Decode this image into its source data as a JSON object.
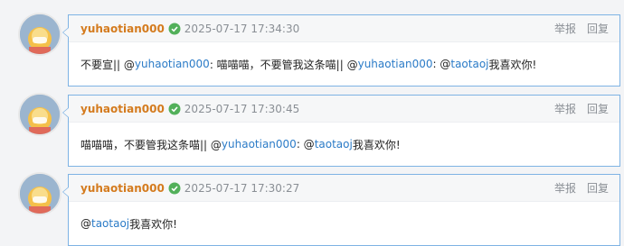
{
  "comments": [
    {
      "username": "yuhaotian000",
      "time": "2025-07-17 17:34:30",
      "report": "举报",
      "reply": "回复",
      "body": {
        "t1": "不要宣|| @",
        "m1": "yuhaotian000",
        "t2": " : 喵喵喵，不要管我这条喵|| @",
        "m2": "yuhaotian000",
        "t3": " : @",
        "m3": "taotaoj",
        "t4": " 我喜欢你!"
      }
    },
    {
      "username": "yuhaotian000",
      "time": "2025-07-17 17:30:45",
      "report": "举报",
      "reply": "回复",
      "body": {
        "t1": "喵喵喵，不要管我这条喵|| @",
        "m1": "yuhaotian000",
        "t2": " : @",
        "m2": "taotaoj",
        "t3": " 我喜欢你!"
      }
    },
    {
      "username": "yuhaotian000",
      "time": "2025-07-17 17:30:27",
      "report": "举报",
      "reply": "回复",
      "body": {
        "t1": "@",
        "m1": "taotaoj",
        "t2": " 我喜欢你!"
      }
    }
  ],
  "colors": {
    "username": "#d47b1e",
    "mention": "#2b7bc7",
    "border": "#7eb3e4",
    "verified": "#52b05a"
  },
  "icons": [
    "avatar",
    "verified-check-icon"
  ]
}
